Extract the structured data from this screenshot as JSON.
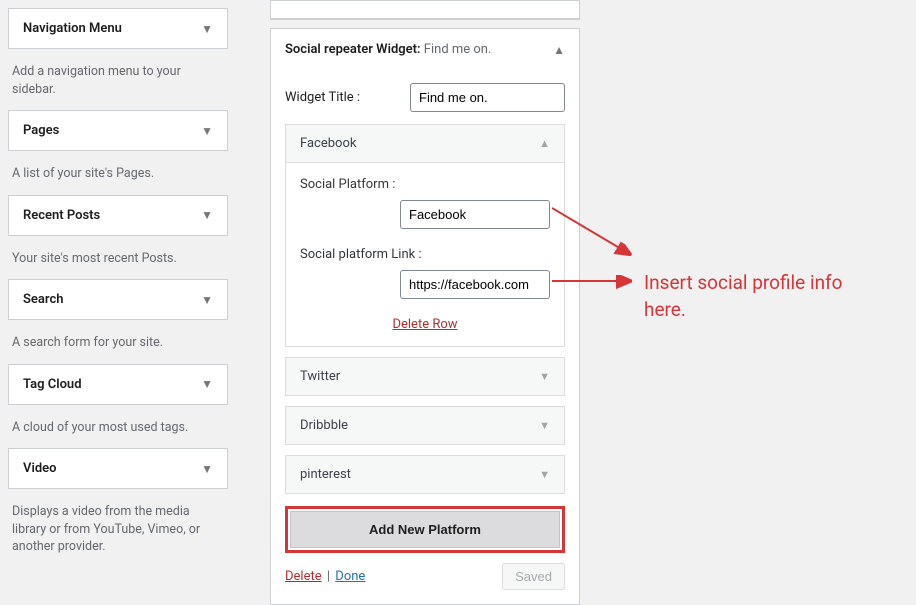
{
  "sidebar": {
    "widgets": [
      {
        "title": "Navigation Menu",
        "desc": "Add a navigation menu to your sidebar."
      },
      {
        "title": "Pages",
        "desc": "A list of your site's Pages."
      },
      {
        "title": "Recent Posts",
        "desc": "Your site's most recent Posts."
      },
      {
        "title": "Search",
        "desc": "A search form for your site."
      },
      {
        "title": "Tag Cloud",
        "desc": "A cloud of your most used tags."
      },
      {
        "title": "Video",
        "desc": "Displays a video from the media library or from YouTube, Vimeo, or another provider."
      }
    ]
  },
  "main": {
    "heading_name": "Social repeater Widget:",
    "heading_sub": "Find me on.",
    "title_label": "Widget Title :",
    "title_value": "Find me on.",
    "platforms": {
      "expanded": {
        "name": "Facebook",
        "platform_label": "Social Platform :",
        "platform_value": "Facebook",
        "link_label": "Social platform Link :",
        "link_value": "https://facebook.com",
        "delete_row": "Delete Row"
      },
      "collapsed": [
        {
          "name": "Twitter"
        },
        {
          "name": "Dribbble"
        },
        {
          "name": "pinterest"
        }
      ]
    },
    "add_platform": "Add New Platform",
    "delete_link": "Delete",
    "done_link": "Done",
    "saved": "Saved"
  },
  "annotation": {
    "text": "Insert social profile info here."
  }
}
